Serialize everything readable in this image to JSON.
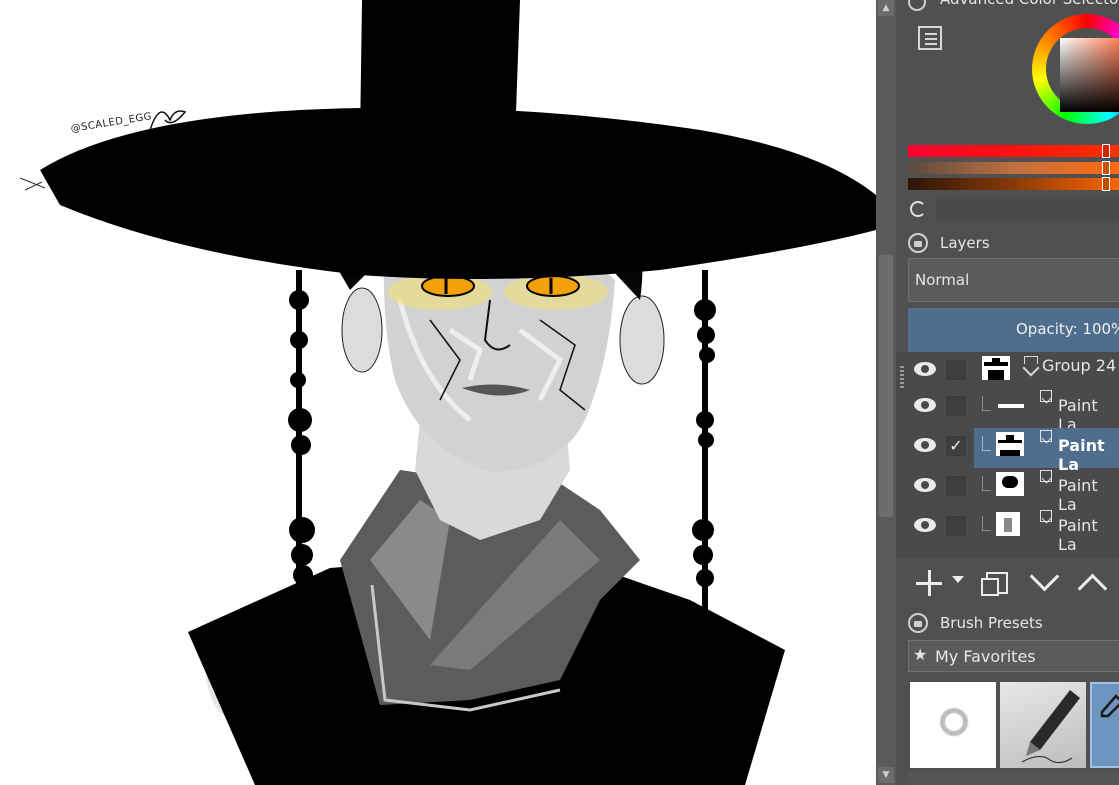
{
  "canvas": {
    "signature_text": "@SCALED_EGG",
    "colors": {
      "background": "#ffffff",
      "ink": "#000000",
      "skin": "#d0d0d0",
      "collar": "#5c5c5c",
      "eyes": "#f0a000"
    }
  },
  "color_selector": {
    "title": "Advanced Color Selecto",
    "menu_icon": "settings-list-icon",
    "refresh_icon": "refresh-icon",
    "current_color": "#ff6a10"
  },
  "layers": {
    "title": "Layers",
    "blend_mode": "Normal",
    "opacity_label": "Opacity:  100%",
    "items": [
      {
        "name": "Group 24",
        "type": "group",
        "visible": true,
        "checked": false,
        "selected": false
      },
      {
        "name": "Paint La",
        "type": "paint",
        "visible": true,
        "checked": false,
        "selected": false
      },
      {
        "name": "Paint La",
        "type": "paint",
        "visible": true,
        "checked": true,
        "selected": true
      },
      {
        "name": "Paint La",
        "type": "paint",
        "visible": true,
        "checked": false,
        "selected": false
      },
      {
        "name": "Paint La",
        "type": "paint",
        "visible": true,
        "checked": false,
        "selected": false
      }
    ],
    "check_mark": "✓",
    "toolbar": {
      "add_icon": "plus-icon",
      "duplicate_icon": "duplicate-icon",
      "move_down_icon": "chevron-down-icon",
      "move_up_icon": "chevron-up-icon"
    }
  },
  "brush_presets": {
    "title": "Brush Presets",
    "tag_star": "★",
    "tag": "My Favorites",
    "presets": [
      "soft-round-brush",
      "ink-pen-brush",
      "pencil-brush"
    ]
  },
  "scrollbar": {
    "up_arrow": "▲",
    "down_arrow": "▼"
  }
}
